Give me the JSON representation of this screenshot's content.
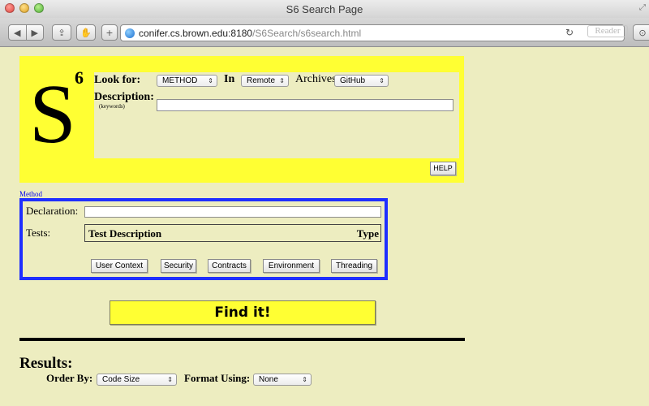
{
  "window": {
    "title": "S6 Search Page"
  },
  "toolbar": {
    "url_host": "conifer.cs.brown.edu:8180",
    "url_path": "/S6Search/s6search.html",
    "reader_label": "Reader",
    "new_tab_label": "+"
  },
  "logo": {
    "letter": "S",
    "superscript": "6"
  },
  "search": {
    "look_for_label": "Look for:",
    "look_for_value": "METHOD",
    "in_label": "In",
    "in_value": "Remote",
    "archives_label": "Archives",
    "archives_value": "GitHub",
    "description_label": "Description:",
    "keywords_note": "(keywords)",
    "description_value": "",
    "help_label": "HELP"
  },
  "method": {
    "link_label": "Method",
    "declaration_label": "Declaration:",
    "declaration_value": "",
    "tests_label": "Tests:",
    "tests_columns": {
      "description": "Test Description",
      "type": "Type"
    },
    "buttons": {
      "user_context": "User Context",
      "security": "Security",
      "contracts": "Contracts",
      "environment": "Environment",
      "threading": "Threading"
    }
  },
  "find_label": "Find it!",
  "results": {
    "title": "Results:",
    "order_by_label": "Order By:",
    "order_by_value": "Code Size",
    "format_label": "Format Using:",
    "format_value": "None"
  },
  "colors": {
    "page_background": "#ededc0",
    "banner_yellow": "#ffff33",
    "method_border_blue": "#1f2fff",
    "link_blue": "#0000ee"
  }
}
